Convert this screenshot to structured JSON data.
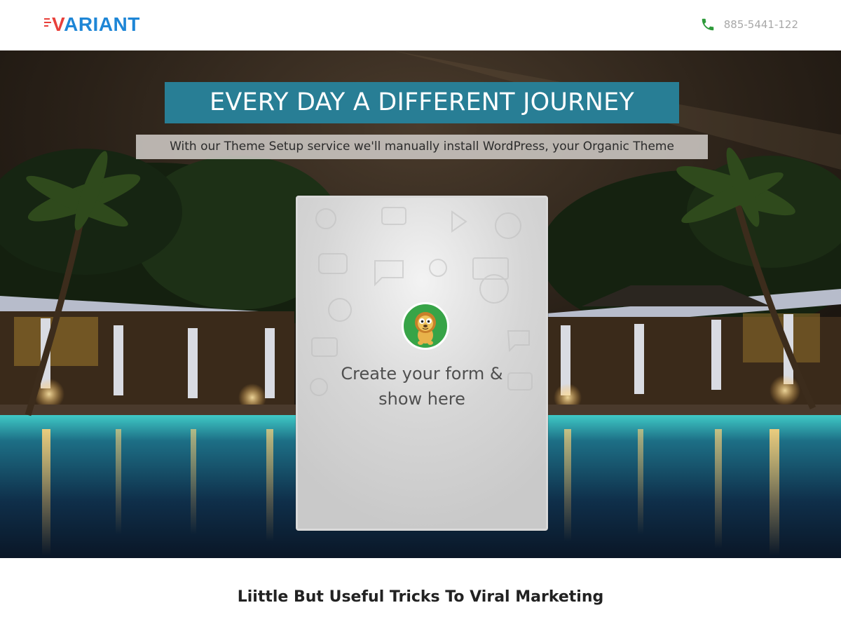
{
  "header": {
    "logo": {
      "first_letter": "V",
      "rest": "ARIANT"
    },
    "phone": {
      "icon": "phone-icon",
      "number": "885-5441-122"
    }
  },
  "hero": {
    "background": "night-resort-pool-photo",
    "headline": "EVERY DAY A DIFFERENT JOURNEY",
    "subheadline": "With our Theme Setup service we'll manually install WordPress, your Organic Theme",
    "form_placeholder": {
      "icon": "lion-mascot-icon",
      "line1": "Create your form &",
      "line2": "show here"
    }
  },
  "section": {
    "title": "Liittle But Useful Tricks To Viral Marketing"
  },
  "colors": {
    "brand_blue": "#1e86d6",
    "brand_red": "#e8403a",
    "headline_bg": "#287e95",
    "phone_green": "#2e9a3a",
    "mascot_green": "#37a447"
  }
}
